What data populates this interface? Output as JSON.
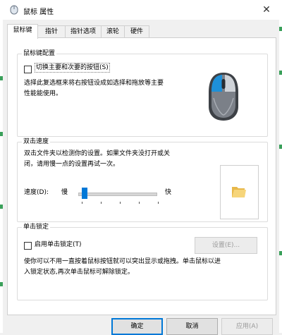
{
  "window": {
    "title": "鼠标 属性",
    "close_glyph": "✕"
  },
  "tabs": [
    {
      "label": "鼠标键",
      "active": true
    },
    {
      "label": "指针"
    },
    {
      "label": "指针选项"
    },
    {
      "label": "滚轮"
    },
    {
      "label": "硬件"
    }
  ],
  "button_config": {
    "legend": "鼠标键配置",
    "switch_label": "切换主要和次要的按钮(S)",
    "switch_checked": false,
    "description_line1": "选择此复选框来将右按钮设成如选择和拖放等主要",
    "description_line2": "性能能使用。"
  },
  "double_click": {
    "legend": "双击速度",
    "description_line1": "双击文件夹以检测你的设置。如果文件夹没打开或关",
    "description_line2": "闭，请用慢一点的设置再试一次。",
    "speed_label": "速度(D):",
    "slow_label": "慢",
    "fast_label": "快",
    "speed_value": 0.05
  },
  "click_lock": {
    "legend": "单击锁定",
    "enable_label": "启用单击锁定(T)",
    "enable_checked": false,
    "settings_button": "设置(E)...",
    "description_line1": "使你可以不用一直按着鼠标按钮就可以突出显示或拖拽。单击鼠标以进",
    "description_line2": "入锁定状态,再次单击鼠标可解除锁定。"
  },
  "footer": {
    "ok": "确定",
    "cancel": "取消",
    "apply": "应用(A)"
  },
  "colors": {
    "accent": "#0078d7",
    "mouse_blue": "#1e90d8"
  }
}
